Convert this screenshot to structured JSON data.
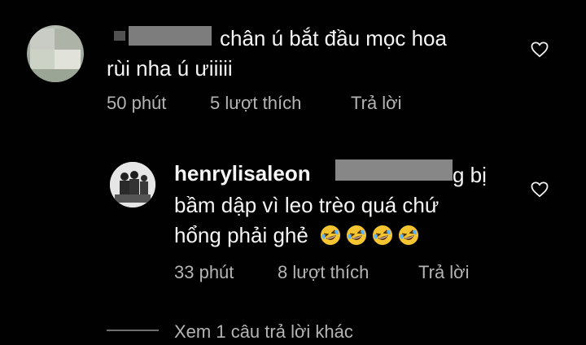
{
  "comment1": {
    "text_line1": "chân ú bắt đầu mọc hoa",
    "text_line2": "rùi nha ú ưiiiii",
    "time": "50 phút",
    "likes": "5 lượt thích",
    "reply": "Trả lời"
  },
  "comment2": {
    "username": "henrylisaleon",
    "text_line1_tail": "g bị",
    "text_line2": "bầm dập vì leo trèo quá chứ",
    "text_line3": "hổng phải ghẻ",
    "emoji_count": 4,
    "time": "33 phút",
    "likes": "8 lượt thích",
    "reply": "Trả lời"
  },
  "view_more": "Xem 1 câu trả lời khác",
  "colors": {
    "background": "#010101",
    "text": "#f5f5f5",
    "meta": "#b4b4b4",
    "emoji": "#f5c531"
  }
}
